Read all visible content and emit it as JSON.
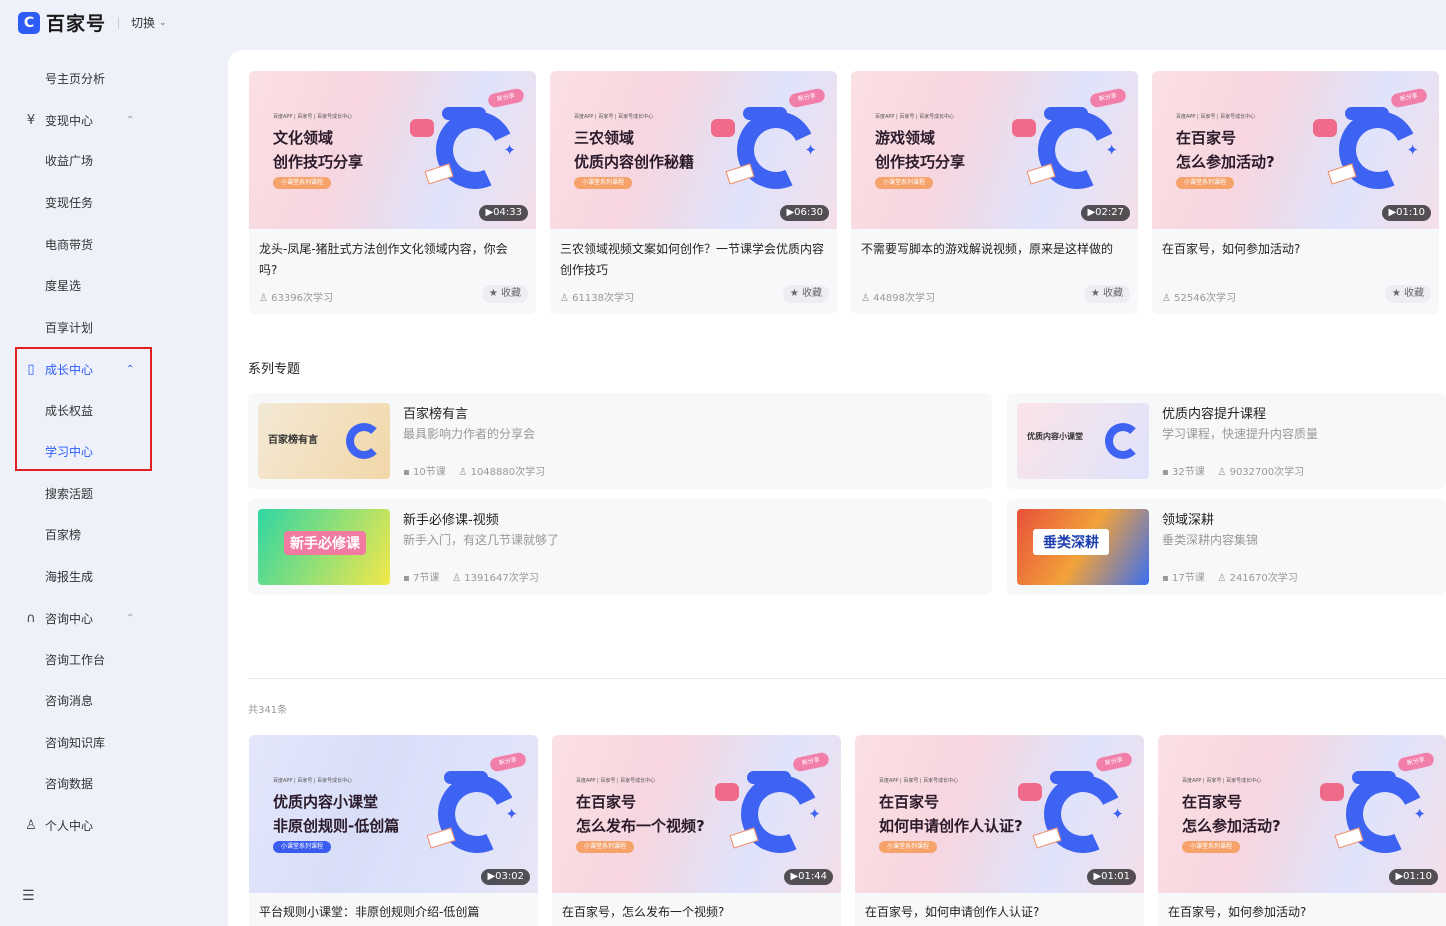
{
  "app": {
    "logo_text": "百家号",
    "switch_label": "切换"
  },
  "sidebar": {
    "items": [
      {
        "label": "号主页分析"
      },
      {
        "label": "变现中心",
        "icon": "yen-circle-icon"
      },
      {
        "label": "收益广场"
      },
      {
        "label": "变现任务"
      },
      {
        "label": "电商带货"
      },
      {
        "label": "度星选"
      },
      {
        "label": "百享计划"
      },
      {
        "label": "成长中心",
        "icon": "book-open-icon"
      },
      {
        "label": "成长权益"
      },
      {
        "label": "学习中心"
      },
      {
        "label": "搜索活题"
      },
      {
        "label": "百家榜"
      },
      {
        "label": "海报生成"
      },
      {
        "label": "咨询中心",
        "icon": "headset-icon"
      },
      {
        "label": "咨询工作台"
      },
      {
        "label": "咨询消息"
      },
      {
        "label": "咨询知识库"
      },
      {
        "label": "咨询数据"
      },
      {
        "label": "个人中心",
        "icon": "user-icon"
      }
    ],
    "active_color": "#2d5cf6",
    "highlight_color": "#e02020"
  },
  "top_courses": [
    {
      "thumb_line1": "文化领域",
      "thumb_line2": "创作技巧分享",
      "pill": "小课堂系列课程",
      "duration": "▶04:33",
      "title": "龙头-凤尾-猪肚式方法创作文化领域内容，你会吗?",
      "learners": "63396次学习",
      "fav": "收藏"
    },
    {
      "thumb_line1": "三农领域",
      "thumb_line2": "优质内容创作秘籍",
      "pill": "小课堂系列课程",
      "duration": "▶06:30",
      "title": "三农领域视频文案如何创作？一节课学会优质内容创作技巧",
      "learners": "61138次学习",
      "fav": "收藏"
    },
    {
      "thumb_line1": "游戏领域",
      "thumb_line2": "创作技巧分享",
      "pill": "小课堂系列课程",
      "duration": "▶02:27",
      "title": "不需要写脚本的游戏解说视频，原来是这样做的",
      "learners": "44898次学习",
      "fav": "收藏"
    },
    {
      "thumb_line1": "在百家号",
      "thumb_line2": "怎么参加活动?",
      "pill": "小课堂系列课程",
      "duration": "▶01:10",
      "title": "在百家号，如何参加活动?",
      "learners": "52546次学习",
      "fav": "收藏"
    }
  ],
  "thumb_brands": "百度APP | 百家号 | 百家号成长中心",
  "thumb_badge": "新分享",
  "series_section": {
    "title": "系列专题",
    "items": [
      {
        "title": "百家榜有言",
        "desc": "最具影响力作者的分享会",
        "lessons": "10节课",
        "learners": "1048880次学习",
        "thumb_text": "百家榜有言"
      },
      {
        "title": "优质内容提升课程",
        "desc": "学习课程，快速提升内容质量",
        "lessons": "32节课",
        "learners": "9032700次学习",
        "thumb_text": "优质内容小课堂"
      },
      {
        "title": "新手必修课-视频",
        "desc": "新手入门，有这几节课就够了",
        "lessons": "7节课",
        "learners": "1391647次学习",
        "thumb_text": "新手必修课"
      },
      {
        "title": "领域深耕",
        "desc": "垂类深耕内容集锦",
        "lessons": "17节课",
        "learners": "241670次学习",
        "thumb_text": "垂类深耕"
      }
    ]
  },
  "total_label": "共341条",
  "bottom_courses": [
    {
      "thumb_line1": "优质内容小课堂",
      "thumb_line2": "非原创规则-低创篇",
      "pill": "小课堂系列课程",
      "duration": "▶03:02",
      "title": "平台规则小课堂：非原创规则介绍-低创篇"
    },
    {
      "thumb_line1": "在百家号",
      "thumb_line2": "怎么发布一个视频?",
      "pill": "小课堂系列课程",
      "duration": "▶01:44",
      "title": "在百家号，怎么发布一个视频?"
    },
    {
      "thumb_line1": "在百家号",
      "thumb_line2": "如何申请创作人认证?",
      "pill": "小课堂系列课程",
      "duration": "▶01:01",
      "title": "在百家号，如何申请创作人认证?"
    },
    {
      "thumb_line1": "在百家号",
      "thumb_line2": "怎么参加活动?",
      "pill": "小课堂系列课程",
      "duration": "▶01:10",
      "title": "在百家号，如何参加活动?"
    }
  ]
}
